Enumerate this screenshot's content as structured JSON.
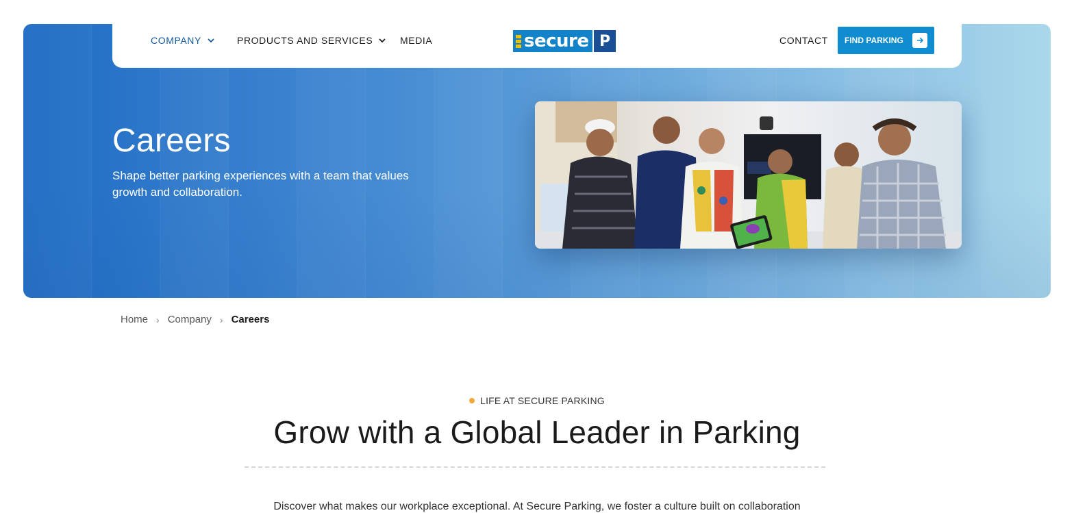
{
  "nav": {
    "items": [
      {
        "label": "COMPANY"
      },
      {
        "label": "PRODUCTS AND SERVICES"
      },
      {
        "label": "MEDIA"
      }
    ],
    "logo_text": "secure",
    "logo_mark": "P",
    "contact": "CONTACT",
    "cta": "FIND PARKING"
  },
  "hero": {
    "title": "Careers",
    "subtitle": "Shape better parking experiences with a team that values growth and collaboration."
  },
  "breadcrumb": [
    "Home",
    "Company",
    "Careers"
  ],
  "section": {
    "eyebrow": "LIFE AT SECURE PARKING",
    "title": "Grow with a Global Leader in Parking",
    "intro": "Discover what makes our workplace exceptional. At Secure Parking, we foster a culture built on collaboration"
  },
  "colors": {
    "brand_blue": "#1283c8",
    "nav_active": "#14589f",
    "cta": "#0f8dd0",
    "eyebrow_dot": "#f2a83a",
    "logo_yellow": "#f2c200"
  },
  "icons": {
    "nav_chevron": "chevron-down-icon",
    "cta_arrow": "arrow-right-icon",
    "breadcrumb_separator": "chevron-right-icon"
  }
}
